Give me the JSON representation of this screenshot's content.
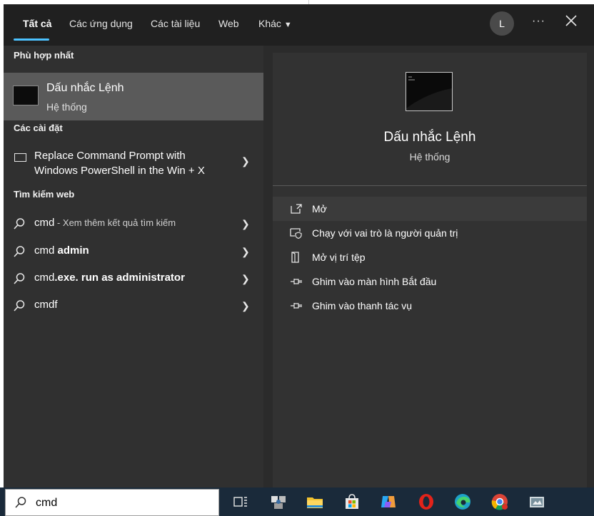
{
  "tabs": [
    {
      "label": "Tất cả"
    },
    {
      "label": "Các ứng dụng"
    },
    {
      "label": "Các tài liệu"
    },
    {
      "label": "Web"
    },
    {
      "label": "Khác"
    }
  ],
  "user": {
    "initial": "L"
  },
  "sections": {
    "best_match": "Phù hợp nhất",
    "settings": "Các cài đặt",
    "web": "Tìm kiếm web"
  },
  "best_match": {
    "title": "Dấu nhắc Lệnh",
    "subtitle": "Hệ thống"
  },
  "settings_items": [
    {
      "line1": "Replace Command Prompt with",
      "line2": "Windows PowerShell in the Win + X"
    }
  ],
  "web_results": [
    {
      "query": "cmd",
      "hint": " - Xem thêm kết quả tìm kiếm"
    },
    {
      "prefix": "cmd ",
      "bold": "admin"
    },
    {
      "prefix": "cmd",
      "bold": ".exe. run as administrator"
    },
    {
      "query": "cmdf"
    }
  ],
  "preview": {
    "title": "Dấu nhắc Lệnh",
    "subtitle": "Hệ thống"
  },
  "actions": [
    {
      "label": "Mở",
      "icon": "open-icon"
    },
    {
      "label": "Chạy với vai trò là người quản trị",
      "icon": "shield-icon"
    },
    {
      "label": "Mở vị trí tệp",
      "icon": "file-location-icon"
    },
    {
      "label": "Ghim vào màn hình Bắt đầu",
      "icon": "pin-icon"
    },
    {
      "label": "Ghim vào thanh tác vụ",
      "icon": "pin-icon"
    }
  ],
  "search": {
    "value": "cmd"
  },
  "colors": {
    "accent": "#4cc2ff",
    "panel": "#2b2b2b",
    "selected": "#5a5a5a"
  }
}
